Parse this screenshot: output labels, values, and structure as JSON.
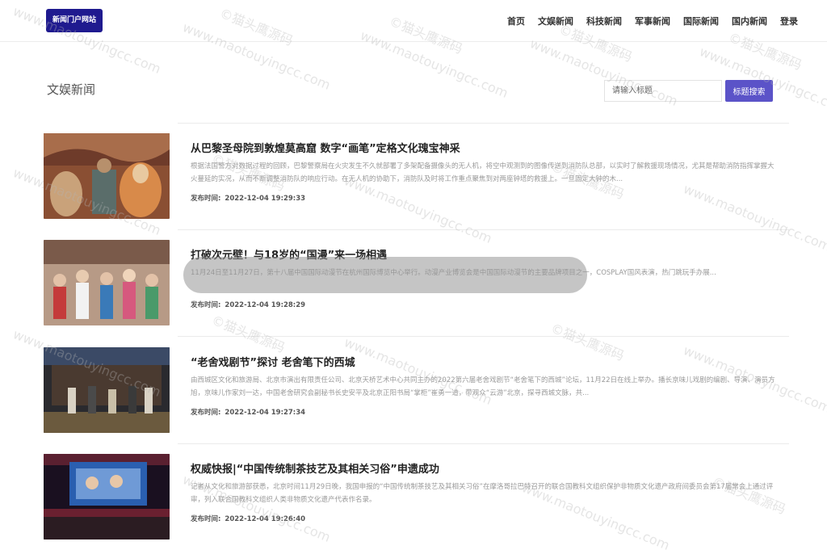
{
  "header": {
    "logo": "新闻门户网站",
    "nav": [
      "首页",
      "文娱新闻",
      "科技新闻",
      "军事新闻",
      "国际新闻",
      "国内新闻",
      "登录"
    ]
  },
  "page": {
    "title": "文娱新闻",
    "search_placeholder": "请输入标题",
    "search_button": "标题搜索"
  },
  "articles": [
    {
      "title": "从巴黎圣母院到敦煌莫高窟 数字“画笔”定格文化瑰宝神采",
      "summary": "根据法国警方对数据过程的回顾，巴黎警察局在火灾发生不久就部署了多架配备摄像头的无人机，将空中观测到的图像传送到消防队总部，以实时了解救援现场情况，尤其是帮助消防指挥掌握大火蔓延的实况，从而不断调整消防队的响应行动。在无人机的协助下，消防队及时将工作重点聚焦到对两座钟塔的救援上。一旦固定大钟的木...",
      "meta_label": "发布时间:",
      "time": "2022-12-04 19:29:33"
    },
    {
      "title": "打破次元壁！与18岁的“国漫”来一场相遇",
      "summary": "11月24日至11月27日，第十八届中国国际动漫节在杭州国际博览中心举行。动漫产业博览会是中国国际动漫节的主要品牌项目之一，COSPLAY国风表演，热门跳玩手办展...",
      "meta_label": "发布时间:",
      "time": "2022-12-04 19:28:29"
    },
    {
      "title": "“老舍戏剧节”探讨 老舍笔下的西城",
      "summary": "由西城区文化和旅游局、北京市演出有限责任公司、北京天桥艺术中心共同主办的2022第六届老舍戏剧节“老舍笔下的西城”论坛，11月22日在线上举办。播长京味儿戏剧的编剧、导演、演员方旭，京味儿作家刘一达，中国老舍研究会副秘书长史安平及北京正阳书局“掌柜”崔勇一道，带观众“云游”北京，探寻西城文脉，共...",
      "meta_label": "发布时间:",
      "time": "2022-12-04 19:27:34"
    },
    {
      "title": "权威快报|“中国传统制茶技艺及其相关习俗”申遗成功",
      "summary": "记者从文化和旅游部获悉，北京时间11月29日晚，我国申报的“中国传统制茶技艺及其相关习俗”在摩洛哥拉巴特召开的联合国教科文组织保护非物质文化遗产政府间委员会第17届常会上通过评审，列入联合国教科文组织人类非物质文化遗产代表作名录。",
      "meta_label": "发布时间:",
      "time": "2022-12-04 19:26:40"
    }
  ],
  "watermark": {
    "cn": "©猫头鹰源码",
    "en": "www.maotouyingcc.com"
  }
}
